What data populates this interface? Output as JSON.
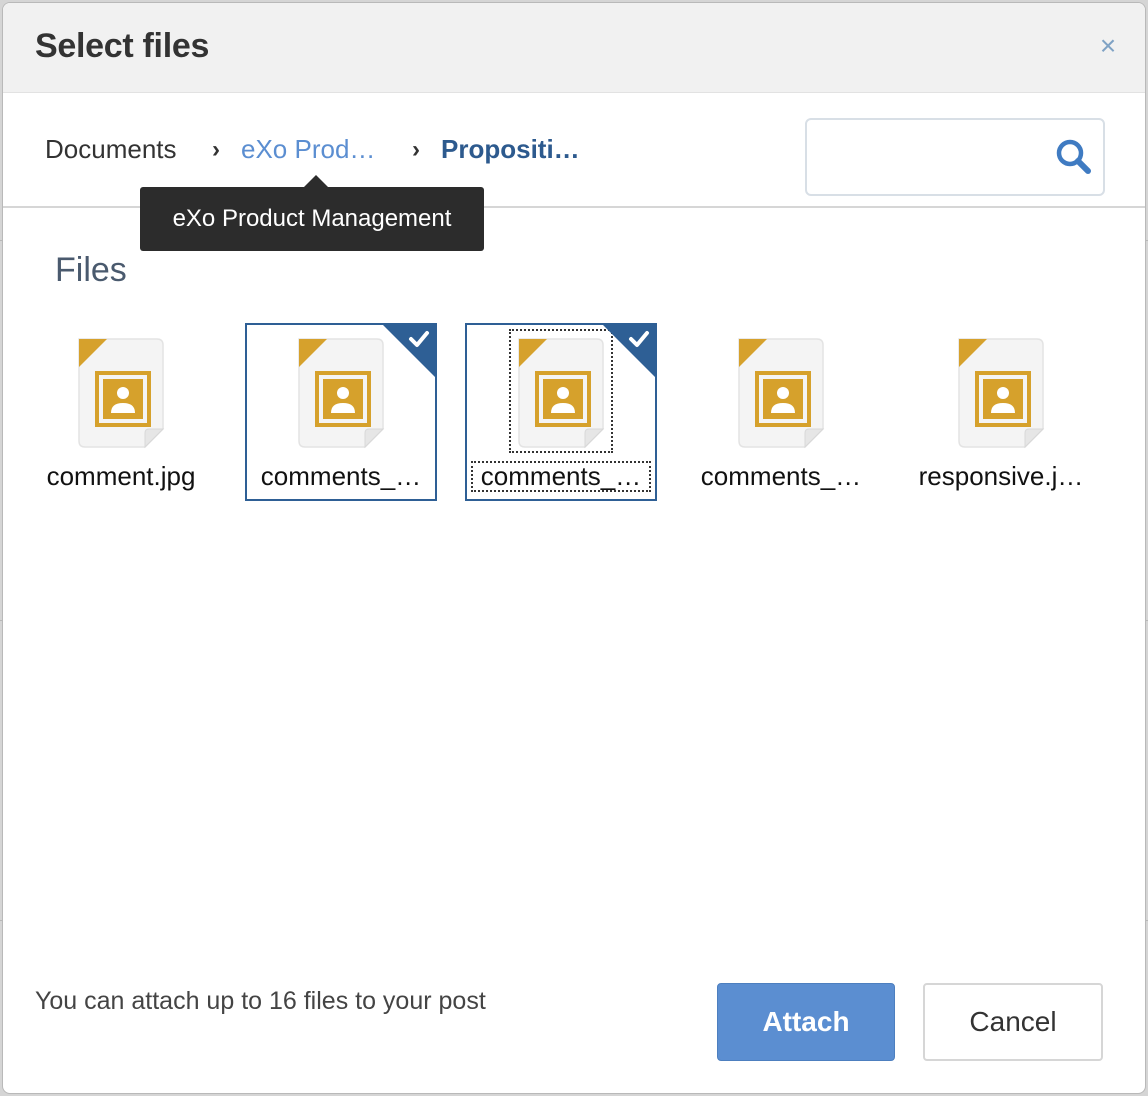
{
  "dialog": {
    "title": "Select files",
    "close_label": "×"
  },
  "breadcrumb": {
    "items": [
      "Documents",
      "eXo Prod…",
      "Propositi…"
    ],
    "separator": "›"
  },
  "tooltip": {
    "text": "eXo Product Management"
  },
  "search": {
    "value": "",
    "placeholder": ""
  },
  "section": {
    "title": "Files"
  },
  "files": [
    {
      "name": "comment.jpg",
      "selected": false
    },
    {
      "name": "comments_…",
      "selected": true
    },
    {
      "name": "comments_…",
      "selected": true
    },
    {
      "name": "comments_…",
      "selected": false
    },
    {
      "name": "responsive.j…",
      "selected": false
    }
  ],
  "footer": {
    "note": "You can attach up to 16 files to your post",
    "attach_label": "Attach",
    "cancel_label": "Cancel"
  },
  "colors": {
    "accent": "#5b8ed1",
    "selection": "#2e5f95",
    "image_icon": "#d6a12c"
  }
}
